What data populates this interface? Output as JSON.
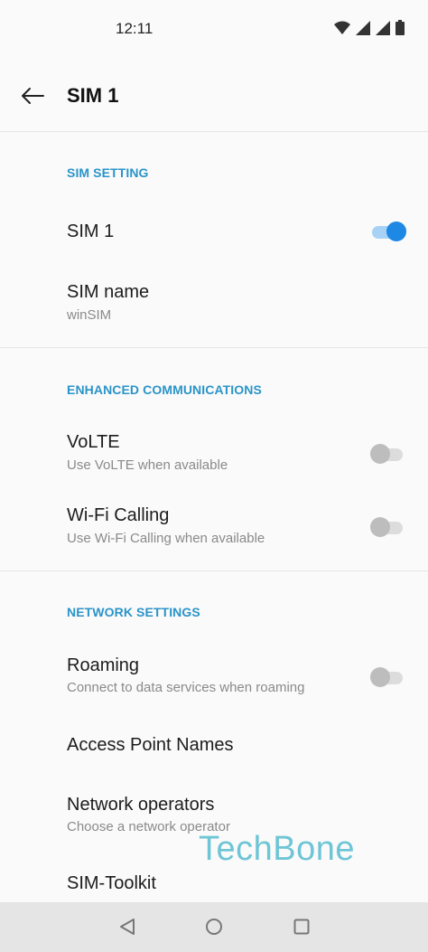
{
  "status_bar": {
    "time": "12:11",
    "icons": [
      "wifi-icon",
      "signal-icon",
      "signal-icon",
      "battery-icon"
    ]
  },
  "app_bar": {
    "title": "SIM 1",
    "back_icon": "arrow-left-icon"
  },
  "sections": {
    "sim_setting": {
      "header": "SIM SETTING",
      "sim1": {
        "title": "SIM 1",
        "enabled": true
      },
      "sim_name": {
        "title": "SIM name",
        "value": "winSIM"
      }
    },
    "enhanced": {
      "header": "ENHANCED COMMUNICATIONS",
      "volte": {
        "title": "VoLTE",
        "subtitle": "Use VoLTE when available",
        "enabled": false
      },
      "wifi_calling": {
        "title": "Wi-Fi Calling",
        "subtitle": "Use Wi-Fi Calling when available",
        "enabled": false
      }
    },
    "network": {
      "header": "NETWORK SETTINGS",
      "roaming": {
        "title": "Roaming",
        "subtitle": "Connect to data services when roaming",
        "enabled": false
      },
      "apn": {
        "title": "Access Point Names"
      },
      "operators": {
        "title": "Network operators",
        "subtitle": "Choose a network operator"
      },
      "toolkit": {
        "title": "SIM-Toolkit"
      }
    }
  },
  "watermark": "TechBone",
  "nav_bar": {
    "back": "triangle-back-icon",
    "home": "circle-home-icon",
    "recents": "square-recents-icon"
  },
  "colors": {
    "accent": "#1e88e5",
    "section_header": "#2a94c8",
    "watermark": "#5fc0d2"
  }
}
